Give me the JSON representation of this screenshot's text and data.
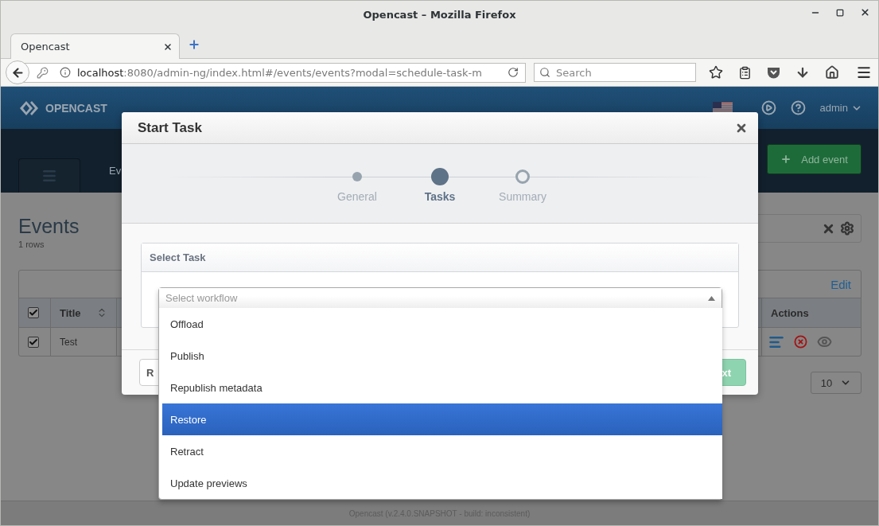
{
  "browser": {
    "window_title": "Opencast – Mozilla Firefox",
    "tabs": [
      {
        "label": "Opencast",
        "selected": true
      }
    ],
    "url": {
      "host": "localhost",
      "path": ":8080/admin-ng/index.html#/events/events?modal=schedule-task-m"
    },
    "search": {
      "placeholder": "Search"
    }
  },
  "header": {
    "logo": "OPENCAST",
    "user": "admin"
  },
  "nav": {
    "tab": "Ev",
    "add_button": "Add event"
  },
  "events": {
    "title": "Events",
    "count": "1 rows",
    "edit_link": "Edit",
    "all_checked": true,
    "columns": [
      {
        "label": "Title",
        "sortable": true
      },
      {
        "label": "Actions",
        "sortable": false
      }
    ],
    "rows": [
      {
        "checked": true,
        "title": "Test"
      }
    ],
    "page_size": "10"
  },
  "footer": "Opencast (v.2.4.0.SNAPSHOT - build: inconsistent)",
  "modal": {
    "title": "Start Task",
    "steps": [
      {
        "label": "General",
        "selected": false,
        "done": true
      },
      {
        "label": "Tasks",
        "selected": true
      },
      {
        "label": "Summary",
        "selected": false,
        "done": false
      }
    ],
    "panel_title": "Select Task",
    "select": {
      "placeholder": "Select workflow",
      "expanded": true,
      "options": [
        {
          "label": "Offload",
          "selected": false
        },
        {
          "label": "Publish",
          "selected": false
        },
        {
          "label": "Republish metadata",
          "selected": false
        },
        {
          "label": "Restore",
          "selected": true
        },
        {
          "label": "Retract",
          "selected": false
        },
        {
          "label": "Update previews",
          "selected": false
        }
      ]
    },
    "buttons": [
      {
        "label": "R",
        "kind": "secondary"
      },
      {
        "label": "xt",
        "kind": "primary"
      }
    ]
  }
}
